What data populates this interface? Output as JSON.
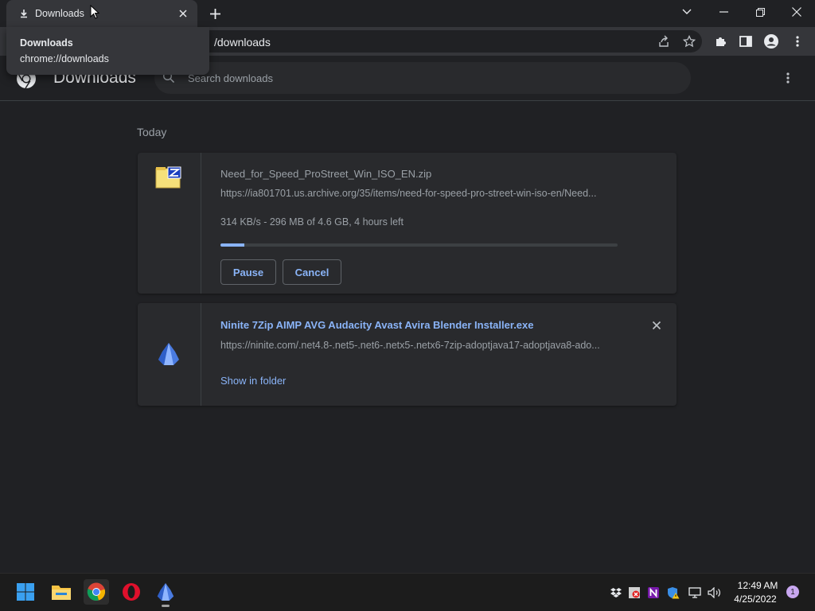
{
  "tab": {
    "title": "Downloads"
  },
  "tooltip": {
    "title": "Downloads",
    "url": "chrome://downloads"
  },
  "omnibox": {
    "url_visible": "/downloads"
  },
  "header": {
    "title": "Downloads",
    "search_placeholder": "Search downloads"
  },
  "section": {
    "date_label": "Today"
  },
  "downloads": [
    {
      "file_name": "Need_for_Speed_ProStreet_Win_ISO_EN.zip",
      "url": "https://ia801701.us.archive.org/35/items/need-for-speed-pro-street-win-iso-en/Need...",
      "status": "314 KB/s - 296 MB of 4.6 GB, 4 hours left",
      "progress": 0.06,
      "pause_label": "Pause",
      "cancel_label": "Cancel",
      "icon": "zip-file-icon"
    },
    {
      "file_name": "Ninite 7Zip AIMP AVG Audacity Avast Avira Blender Installer.exe",
      "url": "https://ninite.com/.net4.8-.net5-.net6-.netx5-.netx6-7zip-adoptjava17-adoptjava8-ado...",
      "show_in_folder_label": "Show in folder",
      "icon": "ninite-icon"
    }
  ],
  "taskbar": {
    "apps": [
      "windows-start-icon",
      "file-explorer-icon",
      "chrome-icon",
      "opera-icon",
      "ninite-icon"
    ],
    "clock_time": "12:49 AM",
    "clock_date": "4/25/2022",
    "notification_count": "1"
  },
  "colors": {
    "accent": "#8ab4f8",
    "background": "#202124",
    "card": "#292a2d"
  }
}
